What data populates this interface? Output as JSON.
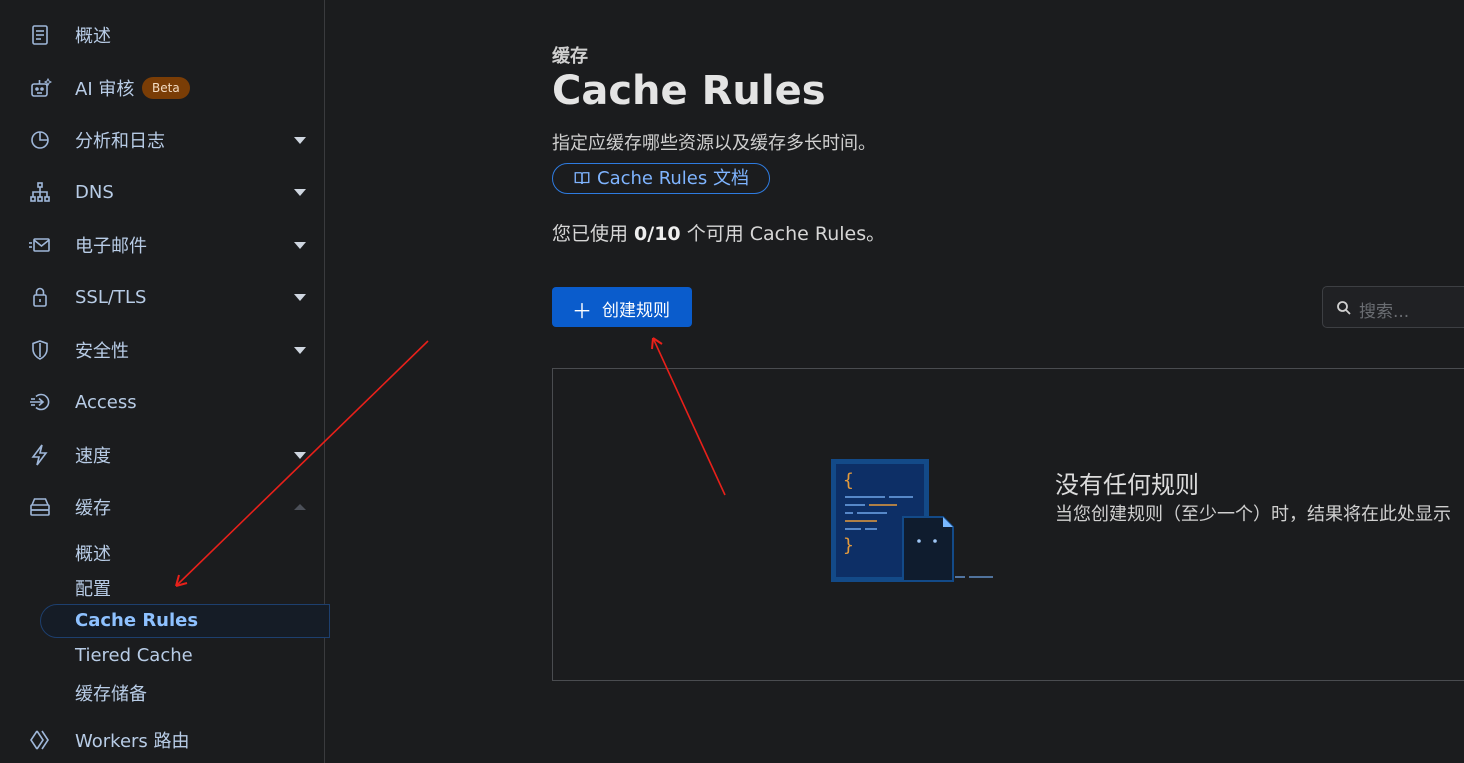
{
  "sidebar": {
    "items": [
      {
        "label": "概述",
        "icon": "document-icon"
      },
      {
        "label": "AI 审核",
        "icon": "robot-icon",
        "badge": "Beta"
      },
      {
        "label": "分析和日志",
        "icon": "pie-chart-icon"
      },
      {
        "label": "DNS",
        "icon": "network-icon"
      },
      {
        "label": "电子邮件",
        "icon": "email-icon"
      },
      {
        "label": "SSL/TLS",
        "icon": "lock-icon"
      },
      {
        "label": "安全性",
        "icon": "shield-icon"
      },
      {
        "label": "Access",
        "icon": "access-icon"
      },
      {
        "label": "速度",
        "icon": "lightning-icon"
      },
      {
        "label": "缓存",
        "icon": "storage-icon"
      },
      {
        "label": "Workers 路由",
        "icon": "workers-icon"
      }
    ],
    "cache_sub": [
      "概述",
      "配置",
      "Cache Rules",
      "Tiered Cache",
      "缓存储备"
    ]
  },
  "main": {
    "kicker": "缓存",
    "title": "Cache Rules",
    "description": "指定应缓存哪些资源以及缓存多长时间。",
    "doc_link": "Cache Rules 文档",
    "usage_prefix": "您已使用 ",
    "usage_count": "0/10",
    "usage_suffix": " 个可用 Cache Rules。",
    "create_button": "创建规则",
    "search_placeholder": "搜索...",
    "empty_title": "没有任何规则",
    "empty_subtitle": "当您创建规则（至少一个）时，结果将在此处显示"
  },
  "colors": {
    "accent": "#0a5ccc",
    "link": "#7fb4ff",
    "annotation": "#e8201a"
  }
}
